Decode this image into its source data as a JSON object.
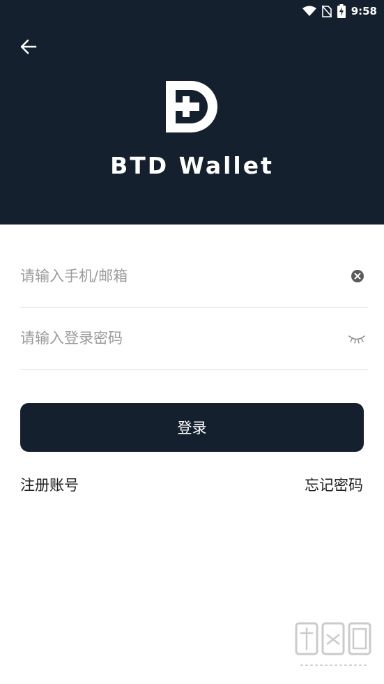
{
  "status_bar": {
    "time": "9:58"
  },
  "header": {
    "app_name": "BTD Wallet",
    "background_color": "#15202e"
  },
  "form": {
    "account_placeholder": "请输入手机/邮箱",
    "password_placeholder": "请输入登录密码",
    "login_label": "登录",
    "register_label": "注册账号",
    "forgot_label": "忘记密码"
  },
  "icons": {
    "status": [
      "wifi-icon",
      "no-sim-icon",
      "battery-charging-icon"
    ],
    "header": [
      "back-arrow-icon",
      "btd-logo"
    ],
    "form": [
      "clear-icon",
      "eye-closed-icon"
    ]
  }
}
